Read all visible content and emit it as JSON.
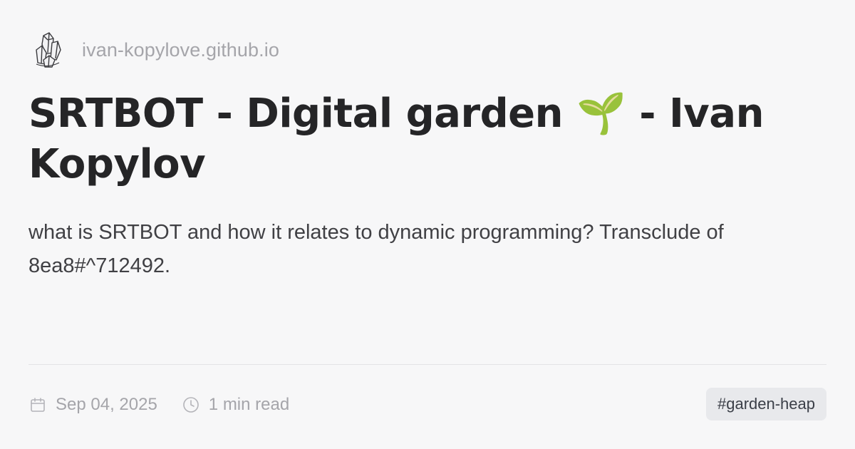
{
  "site": {
    "logo_icon": "crystal-logo-icon",
    "name": "ivan-kopylove.github.io"
  },
  "post": {
    "title": "SRTBOT - Digital garden 🌱 - Ivan Kopylov",
    "description": "what is SRTBOT and how it relates to dynamic programming? Transclude of 8ea8#^712492."
  },
  "meta": {
    "date_icon": "calendar-icon",
    "date": "Sep 04, 2025",
    "read_icon": "clock-icon",
    "read_time": "1 min read"
  },
  "tag": {
    "label": "#garden-heap"
  },
  "colors": {
    "background": "#f7f7f8",
    "title": "#252527",
    "muted": "#a5a5aa",
    "tag_bg": "#e8e9ec"
  }
}
